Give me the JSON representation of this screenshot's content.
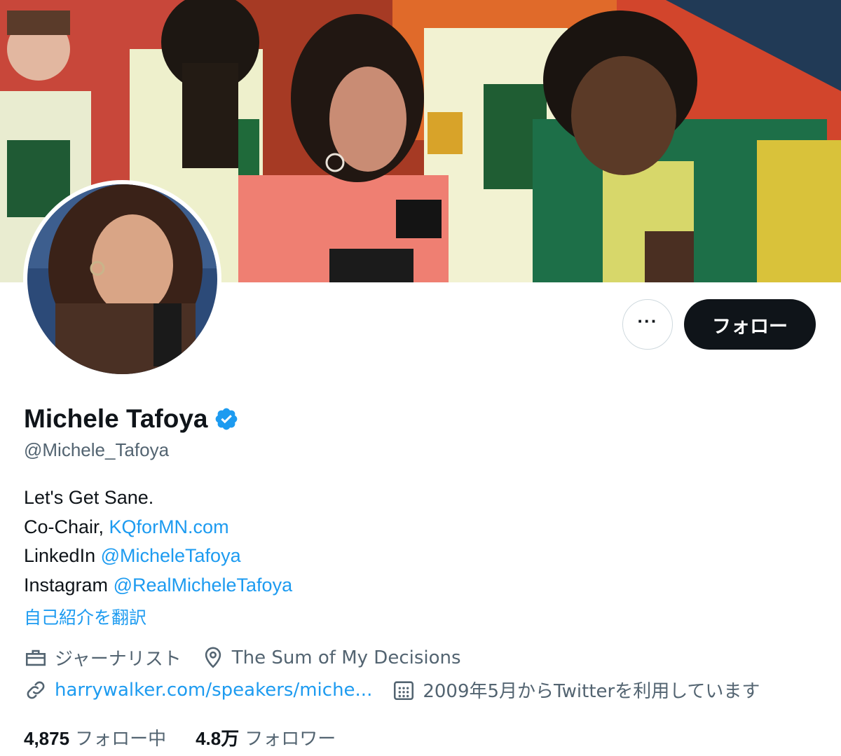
{
  "profile": {
    "name": "Michele Tafoya",
    "handle": "@Michele_Tafoya",
    "follow_label": "フォロー",
    "more_label": "···",
    "bio": {
      "line1": "Let's Get Sane.",
      "line2_prefix": "Co-Chair, ",
      "line2_link": "KQforMN.com",
      "line3_prefix": "LinkedIn ",
      "line3_link": "@MicheleTafoya",
      "line4_prefix": "Instagram ",
      "line4_link": "@RealMicheleTafoya"
    },
    "translate_label": "自己紹介を翻訳",
    "profession": "ジャーナリスト",
    "location": "The Sum of My Decisions",
    "website": "harrywalker.com/speakers/miche...",
    "joined": "2009年5月からTwitterを利用しています",
    "following_count": "4,875",
    "following_label": "フォロー中",
    "followers_count": "4.8万",
    "followers_label": "フォロワー"
  },
  "icons": {
    "verified": "verified-badge-icon",
    "more": "more-dots-icon",
    "profession": "briefcase-icon",
    "location": "location-pin-icon",
    "website": "link-icon",
    "joined": "calendar-icon"
  },
  "colors": {
    "accent": "#1d9bf0",
    "text": "#0f1419",
    "secondary": "#536471",
    "follow_button": "#0f1419"
  }
}
